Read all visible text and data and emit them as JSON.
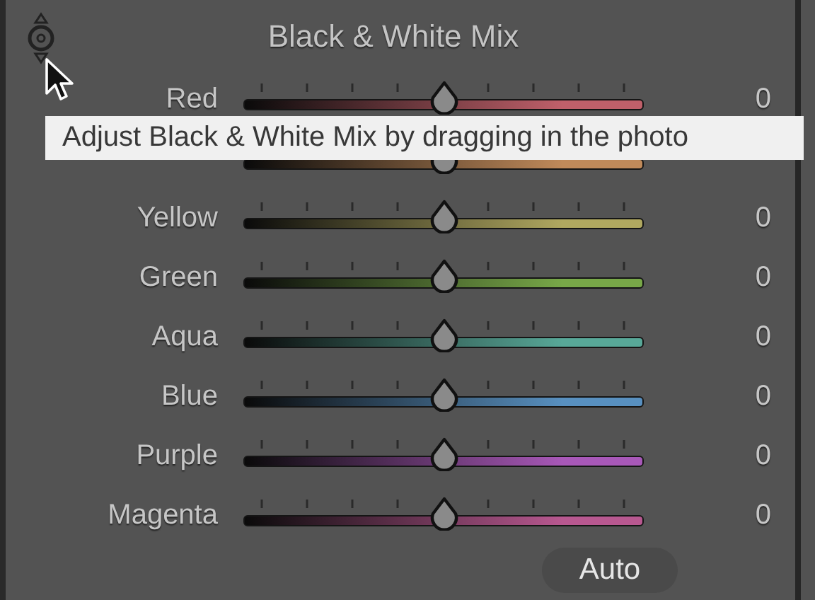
{
  "panel": {
    "title": "Black & White Mix"
  },
  "sliders": [
    {
      "name": "Red",
      "color": "#c0606a",
      "level": 0.5,
      "reading": "0"
    },
    {
      "color": "#c08a5a",
      "level": 0.5
    },
    {
      "name": "Yellow",
      "color": "#b0a860",
      "level": 0.5,
      "reading": "0"
    },
    {
      "name": "Green",
      "color": "#78a848",
      "level": 0.5,
      "reading": "0"
    },
    {
      "name": "Aqua",
      "color": "#58a898",
      "level": 0.5,
      "reading": "0"
    },
    {
      "name": "Blue",
      "color": "#5890c0",
      "level": 0.5,
      "reading": "0"
    },
    {
      "name": "Purple",
      "color": "#a858b8",
      "level": 0.5,
      "reading": "0"
    },
    {
      "name": "Magenta",
      "color": "#b85890",
      "level": 0.5,
      "reading": "0"
    }
  ],
  "auto_button": {
    "label": "Auto"
  },
  "tooltip": {
    "text": "Adjust Black & White Mix by dragging in the photo"
  }
}
